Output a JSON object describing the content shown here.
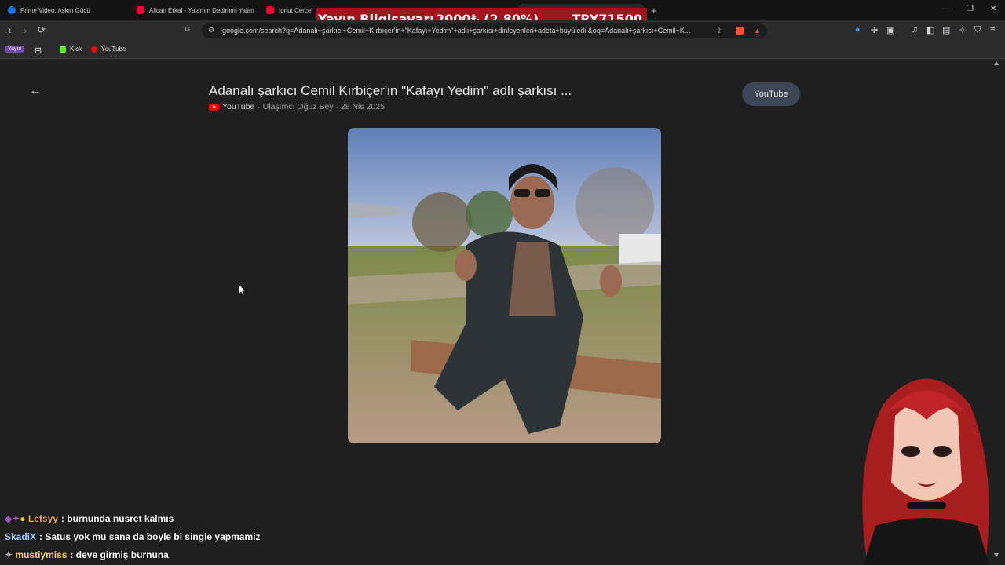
{
  "tabs": [
    {
      "label": "Prime Video: Aşkın Gücü",
      "color": "#1a73e8"
    },
    {
      "label": "Alican Erkal - Yalanım Dedimmi Yalan",
      "color": "#ff0033"
    },
    {
      "label": "Ionut Cercel",
      "color": "#ff0033"
    }
  ],
  "overlay": {
    "label": "Yayın Bilgisayarı",
    "change": "2000₺ (2.80%)",
    "price": "TRY71500"
  },
  "address": {
    "url": "google.com/search?q=Adanalı+şarkıcı+Cemil+Kırbıçer'in+\"Kafayı+Yedim\"+adlı+şarkısı+dinleyenleri+adeta+büyüledi.&oq=Adanalı+şarkıcı+Cemil+K..."
  },
  "bookmarks": {
    "yayin": "Yayın",
    "kick": "Kick",
    "youtube": "YouTube"
  },
  "result": {
    "title": "Adanalı şarkıcı Cemil Kırbiçer'in \"Kafayı Yedim\" adlı şarkısı ...",
    "source": "YouTube",
    "channel": "· Ulaşımcı Oğuz Bey · 28 Nis 2025",
    "chip": "YouTube"
  },
  "chat": [
    {
      "user": "Lefsyy",
      "color": "#f2a93b",
      "message": ": burnunda nusret kalmıs"
    },
    {
      "user": "SkadiX",
      "color": "#9bd0ff",
      "message": ": Satus yok mu sana da boyle bi single yapmamiz"
    },
    {
      "user": "mustiymiss",
      "color": "#ffd24a",
      "message": ": deve girmiş burnuna"
    }
  ],
  "colors": {
    "background": "#1f1f1f",
    "banner": "#a5121c",
    "chip": "#3c4654"
  }
}
